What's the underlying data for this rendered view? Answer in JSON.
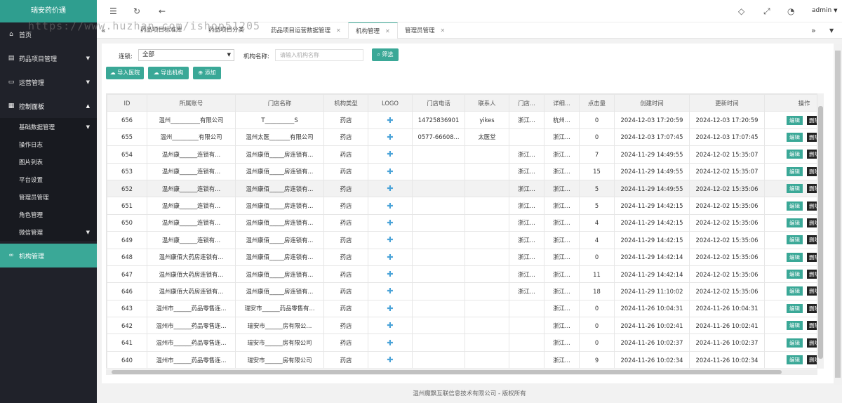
{
  "app": {
    "title": "瑞安药价通",
    "user": "admin"
  },
  "watermark": "https://www.huzhan.com/ishop51205",
  "sidebar": {
    "items": [
      {
        "label": "首页",
        "icon": "home-icon"
      },
      {
        "label": "药品项目管理",
        "icon": "bag-icon"
      },
      {
        "label": "运营管理",
        "icon": "monitor-icon"
      },
      {
        "label": "控制面板",
        "icon": "panel-icon"
      }
    ],
    "sub_items": [
      "基础数据管理",
      "操作日志",
      "图片列表",
      "平台设置",
      "管理员管理",
      "角色管理",
      "微信管理"
    ],
    "active": "机构管理"
  },
  "tabs": [
    {
      "label": "药品项目标准库"
    },
    {
      "label": "药品项目分类"
    },
    {
      "label": "药品项目运营数据管理"
    },
    {
      "label": "机构管理"
    },
    {
      "label": "管理员管理"
    }
  ],
  "filter": {
    "chain_label": "连锁:",
    "chain_value": "全部",
    "name_label": "机构名称:",
    "name_placeholder": "请输入机构名称",
    "search_btn": "筛选"
  },
  "actions": {
    "import": "导入医院",
    "export": "导出机构",
    "add": "添加"
  },
  "table": {
    "headers": [
      "ID",
      "所属账号",
      "门店名称",
      "机构类型",
      "LOGO",
      "门店电话",
      "联系人",
      "门店...",
      "详细...",
      "点击量",
      "创建时间",
      "更新时间",
      "操作"
    ],
    "rows": [
      {
        "id": "656",
        "acct": "温州__________有限公司",
        "store": "T__________S",
        "type": "药店",
        "phone": "14725836901",
        "contact": "yikes",
        "s1": "浙江...",
        "s2": "杭州...",
        "clicks": "0",
        "created": "2024-12-03 17:20:59",
        "updated": "2024-12-03 17:20:59"
      },
      {
        "id": "655",
        "acct": "温州_________有限公司",
        "store": "温州太医_______有限公司",
        "type": "药店",
        "phone": "0577-66608...",
        "contact": "太医堂",
        "s1": "",
        "s2": "浙江...",
        "clicks": "0",
        "created": "2024-12-03 17:07:45",
        "updated": "2024-12-03 17:07:45"
      },
      {
        "id": "654",
        "acct": "温州康______连锁有...",
        "store": "温州康佰_____房连锁有...",
        "type": "药店",
        "phone": "",
        "contact": "",
        "s1": "浙江...",
        "s2": "浙江...",
        "clicks": "7",
        "created": "2024-11-29 14:49:55",
        "updated": "2024-12-02 15:35:07"
      },
      {
        "id": "653",
        "acct": "温州康______连锁有...",
        "store": "温州康佰_____房连锁有...",
        "type": "药店",
        "phone": "",
        "contact": "",
        "s1": "浙江...",
        "s2": "浙江...",
        "clicks": "15",
        "created": "2024-11-29 14:49:55",
        "updated": "2024-12-02 15:35:07"
      },
      {
        "id": "652",
        "acct": "温州康______连锁有...",
        "store": "温州康佰_____房连锁有...",
        "type": "药店",
        "phone": "",
        "contact": "",
        "s1": "浙江...",
        "s2": "浙江...",
        "clicks": "5",
        "created": "2024-11-29 14:49:55",
        "updated": "2024-12-02 15:35:06"
      },
      {
        "id": "651",
        "acct": "温州康______连锁有...",
        "store": "温州康佰_____房连锁有...",
        "type": "药店",
        "phone": "",
        "contact": "",
        "s1": "浙江...",
        "s2": "浙江...",
        "clicks": "5",
        "created": "2024-11-29 14:42:15",
        "updated": "2024-12-02 15:35:06"
      },
      {
        "id": "650",
        "acct": "温州康______连锁有...",
        "store": "温州康佰_____房连锁有...",
        "type": "药店",
        "phone": "",
        "contact": "",
        "s1": "浙江...",
        "s2": "浙江...",
        "clicks": "4",
        "created": "2024-11-29 14:42:15",
        "updated": "2024-12-02 15:35:06"
      },
      {
        "id": "649",
        "acct": "温州康______连锁有...",
        "store": "温州康佰_____房连锁有...",
        "type": "药店",
        "phone": "",
        "contact": "",
        "s1": "浙江...",
        "s2": "浙江...",
        "clicks": "4",
        "created": "2024-11-29 14:42:15",
        "updated": "2024-12-02 15:35:06"
      },
      {
        "id": "648",
        "acct": "温州康佰大药房连锁有...",
        "store": "温州康佰_____房连锁有...",
        "type": "药店",
        "phone": "",
        "contact": "",
        "s1": "浙江...",
        "s2": "浙江...",
        "clicks": "0",
        "created": "2024-11-29 14:42:14",
        "updated": "2024-12-02 15:35:06"
      },
      {
        "id": "647",
        "acct": "温州康佰大药房连锁有...",
        "store": "温州康佰_____房连锁有...",
        "type": "药店",
        "phone": "",
        "contact": "",
        "s1": "浙江...",
        "s2": "浙江...",
        "clicks": "11",
        "created": "2024-11-29 14:42:14",
        "updated": "2024-12-02 15:35:06"
      },
      {
        "id": "646",
        "acct": "温州康佰大药房连锁有...",
        "store": "温州康佰_____房连锁有...",
        "type": "药店",
        "phone": "",
        "contact": "",
        "s1": "浙江...",
        "s2": "浙江...",
        "clicks": "18",
        "created": "2024-11-29 11:10:02",
        "updated": "2024-12-02 15:35:06"
      },
      {
        "id": "643",
        "acct": "温州市______药品零售连...",
        "store": "瑞安市______药品零售有...",
        "type": "药店",
        "phone": "",
        "contact": "",
        "s1": "",
        "s2": "浙江...",
        "clicks": "0",
        "created": "2024-11-26 10:04:31",
        "updated": "2024-11-26 10:04:31"
      },
      {
        "id": "642",
        "acct": "温州市______药品零售连...",
        "store": "瑞安市______房有限公...",
        "type": "药店",
        "phone": "",
        "contact": "",
        "s1": "",
        "s2": "浙江...",
        "clicks": "0",
        "created": "2024-11-26 10:02:41",
        "updated": "2024-11-26 10:02:41"
      },
      {
        "id": "641",
        "acct": "温州市______药品零售连...",
        "store": "瑞安市______房有限公司",
        "type": "药店",
        "phone": "",
        "contact": "",
        "s1": "",
        "s2": "浙江...",
        "clicks": "0",
        "created": "2024-11-26 10:02:37",
        "updated": "2024-11-26 10:02:37"
      },
      {
        "id": "640",
        "acct": "温州市______药品零售连...",
        "store": "瑞安市______房有限公司",
        "type": "药店",
        "phone": "",
        "contact": "",
        "s1": "",
        "s2": "浙江...",
        "clicks": "9",
        "created": "2024-11-26 10:02:34",
        "updated": "2024-11-26 10:02:34"
      }
    ],
    "edit_label": "编辑",
    "delete_label": "删除",
    "highlight_index": 4
  },
  "footer": "温州魔飘互联信息技术有限公司 - 版权所有",
  "colors": {
    "accent": "#3aa897",
    "sidebar": "#20222a"
  }
}
